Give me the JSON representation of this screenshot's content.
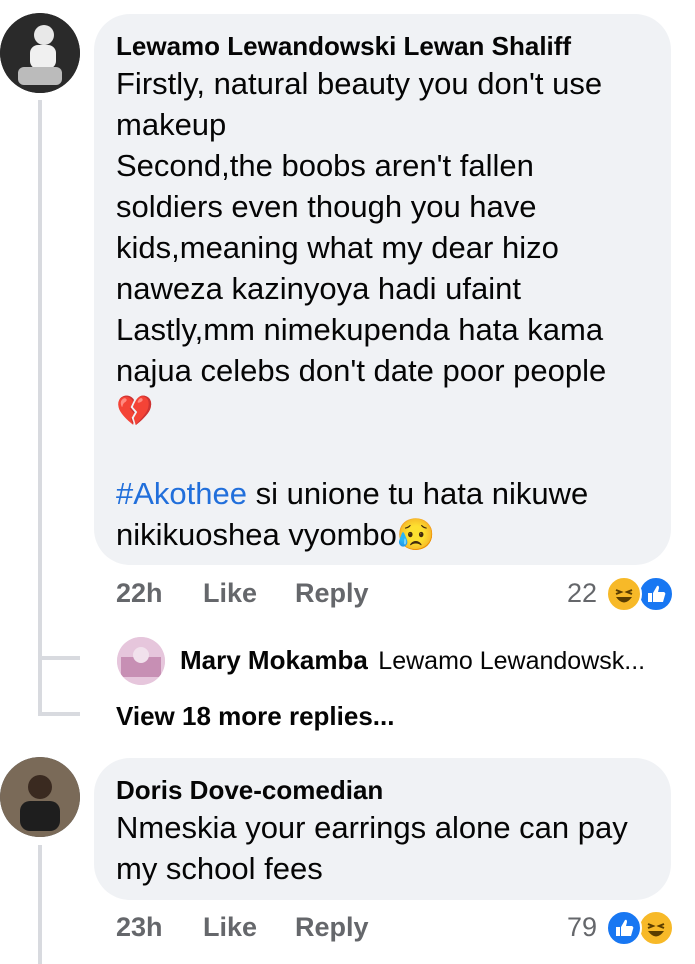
{
  "comments": [
    {
      "author": "Lewamo Lewandowski Lewan Shaliff",
      "lines": [
        "Firstly, natural beauty you don't use",
        "makeup",
        "Second,the boobs aren't fallen",
        "soldiers even though you have",
        "kids,meaning what my dear hizo",
        "naweza kazinyoya hadi ufaint",
        "Lastly,mm nimekupenda hata kama",
        "najua celebs don't date poor people"
      ],
      "emoji_break": "💔",
      "hashtag": "#Akothee",
      "after_hashtag": " si unione tu hata nikuwe",
      "last_line": "nikikuoshea vyombo",
      "last_emoji": "😥",
      "time": "22h",
      "like_label": "Like",
      "reply_label": "Reply",
      "reaction_count": "22",
      "reactions": [
        "haha-icon",
        "like-icon"
      ],
      "reply_preview": {
        "name": "Mary Mokamba",
        "snippet": "Lewamo Lewandowsk..."
      },
      "view_more": "View 18 more replies..."
    },
    {
      "author": "Doris Dove-comedian",
      "lines": [
        "Nmeskia your earrings alone can pay",
        "my school fees"
      ],
      "time": "23h",
      "like_label": "Like",
      "reply_label": "Reply",
      "reaction_count": "79",
      "reactions": [
        "like-icon",
        "haha-icon"
      ]
    }
  ],
  "colors": {
    "bubble": "#f0f2f5",
    "hashtag": "#216fdb",
    "meta": "#65676b",
    "like_blue": "#1877f2",
    "haha_yellow": "#f7b928"
  }
}
